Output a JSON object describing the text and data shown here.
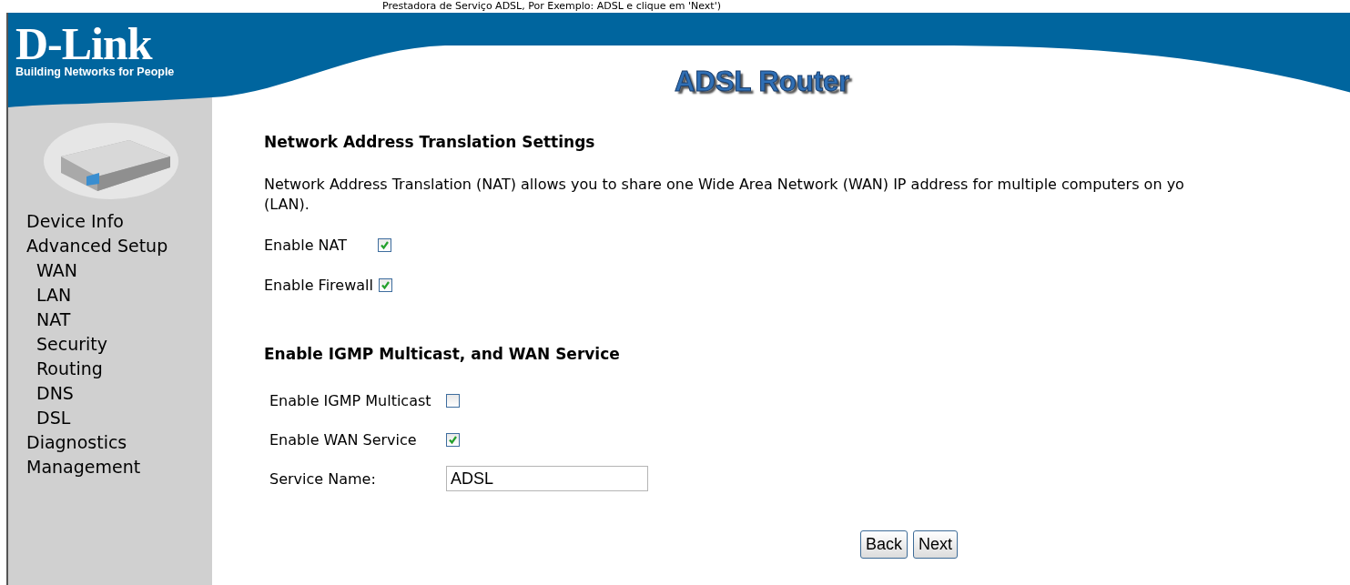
{
  "top_note": "Prestadora de Serviço ADSL, Por Exemplo: ADSL e clique em 'Next')",
  "logo": {
    "name": "D-Link",
    "tagline": "Building Networks for People"
  },
  "title": "ADSL Router",
  "sidebar": {
    "items": [
      {
        "label": "Device Info"
      },
      {
        "label": "Advanced Setup",
        "children": [
          {
            "label": "WAN"
          },
          {
            "label": "LAN"
          },
          {
            "label": "NAT"
          },
          {
            "label": "Security"
          },
          {
            "label": "Routing"
          },
          {
            "label": "DNS"
          },
          {
            "label": "DSL"
          }
        ]
      },
      {
        "label": "Diagnostics"
      },
      {
        "label": "Management"
      }
    ]
  },
  "nat_section": {
    "heading": "Network Address Translation Settings",
    "description_lines": [
      "Network Address Translation (NAT) allows you to share one Wide Area Network (WAN) IP address for multiple computers on yo",
      "(LAN)."
    ],
    "options": [
      {
        "label": "Enable NAT",
        "checked": true
      },
      {
        "label": "Enable Firewall",
        "checked": true
      }
    ]
  },
  "wan_section": {
    "heading": "Enable IGMP Multicast, and WAN Service",
    "fields": [
      {
        "kind": "checkbox",
        "label": "Enable IGMP Multicast",
        "checked": false
      },
      {
        "kind": "checkbox",
        "label": "Enable WAN Service",
        "checked": true
      },
      {
        "kind": "text",
        "label": "Service Name:",
        "value": "ADSL"
      }
    ]
  },
  "buttons": [
    "Back",
    "Next"
  ]
}
